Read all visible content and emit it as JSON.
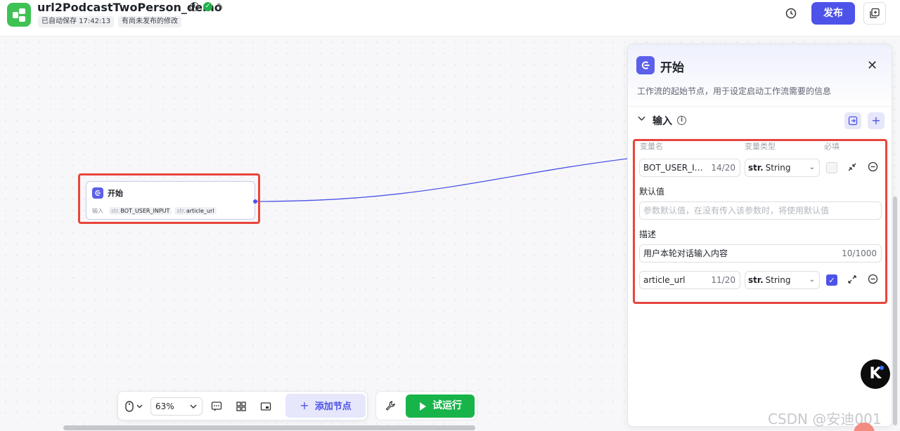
{
  "header": {
    "title": "url2PodcastTwoPerson_demo",
    "autosave": "已自动保存 17:42:13",
    "unpublished": "有尚未发布的修改",
    "publish_label": "发布",
    "info_glyph": "i",
    "ok_glyph": "✓",
    "edit_glyph": "✎"
  },
  "canvas_node": {
    "title": "开始",
    "input_label": "输入",
    "chips": [
      {
        "type": "str.",
        "name": "BOT_USER_INPUT"
      },
      {
        "type": "str.",
        "name": "article_url"
      }
    ]
  },
  "toolbar": {
    "zoom": "63%",
    "add_node_label": "添加节点",
    "run_label": "试运行"
  },
  "panel": {
    "title": "开始",
    "description": "工作流的起始节点，用于设定启动工作流需要的信息",
    "section_title": "输入",
    "columns": {
      "name": "变量名",
      "type": "变量类型",
      "required": "必填"
    },
    "variables": [
      {
        "name": "BOT_USER_I…",
        "count": "14/20",
        "type_prefix": "str.",
        "type": "String",
        "required": false,
        "default_label": "默认值",
        "default_placeholder": "参数默认值，在没有传入该参数时，将使用默认值",
        "desc_label": "描述",
        "desc_value": "用户本轮对话输入内容",
        "desc_count": "10/1000"
      },
      {
        "name": "article_url",
        "count": "11/20",
        "type_prefix": "str.",
        "type": "String",
        "required": true
      }
    ],
    "close_glyph": "✕",
    "add_glyph": "+",
    "chevron_glyph": "⌄"
  },
  "float_button": "K",
  "watermark": "CSDN @安迪001",
  "colors": {
    "accent": "#4d53e8",
    "run_green": "#18b44a",
    "logo_green": "#3ec254",
    "highlight_red": "#e8453c"
  }
}
